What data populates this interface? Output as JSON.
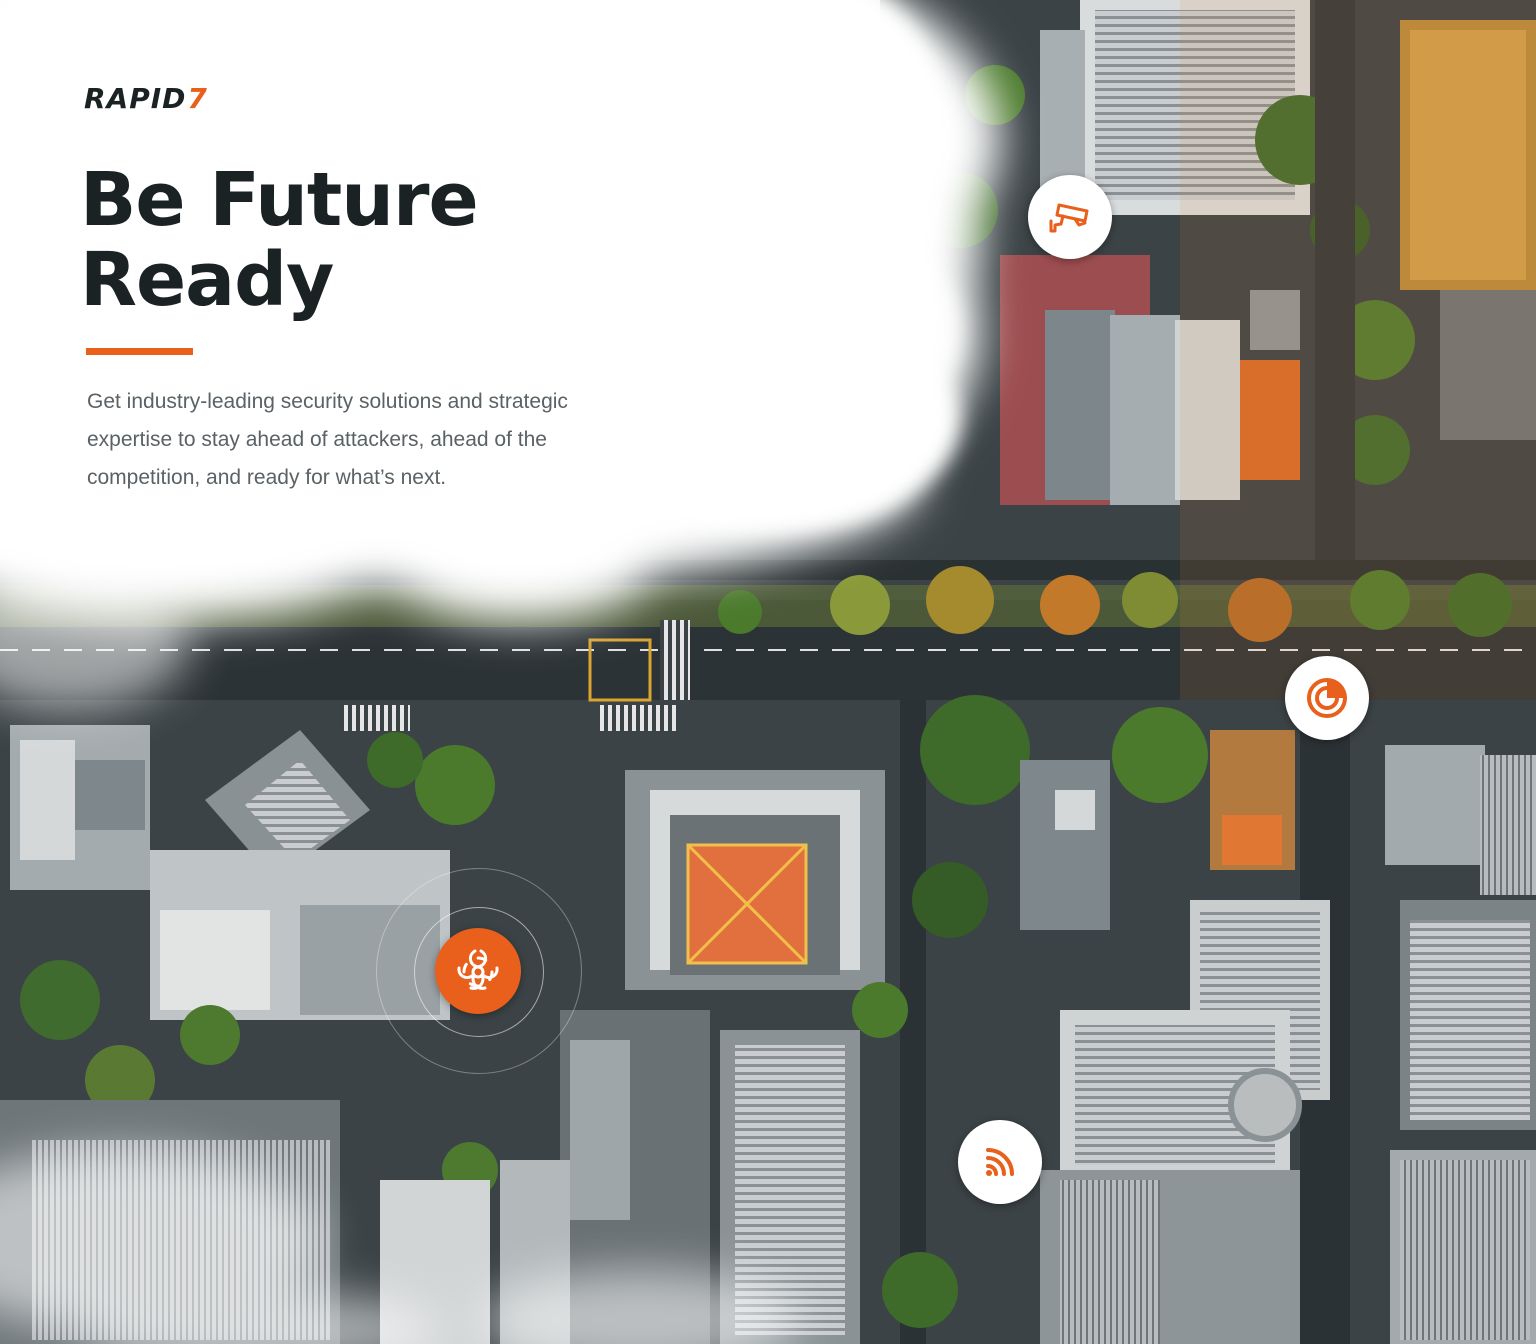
{
  "brand": {
    "name": "RAPID",
    "mark": "7",
    "accent_color": "#e8601c"
  },
  "hero": {
    "headline": "Be Future Ready",
    "body": "Get industry-leading security solutions and strategic expertise to stay ahead of attackers, ahead of the competition, and ready for what’s next."
  },
  "hotspots": [
    {
      "icon": "security-camera-icon",
      "style": "white"
    },
    {
      "icon": "radar-icon",
      "style": "white"
    },
    {
      "icon": "biohazard-icon",
      "style": "orange"
    },
    {
      "icon": "wireless-signal-icon",
      "style": "white"
    }
  ]
}
